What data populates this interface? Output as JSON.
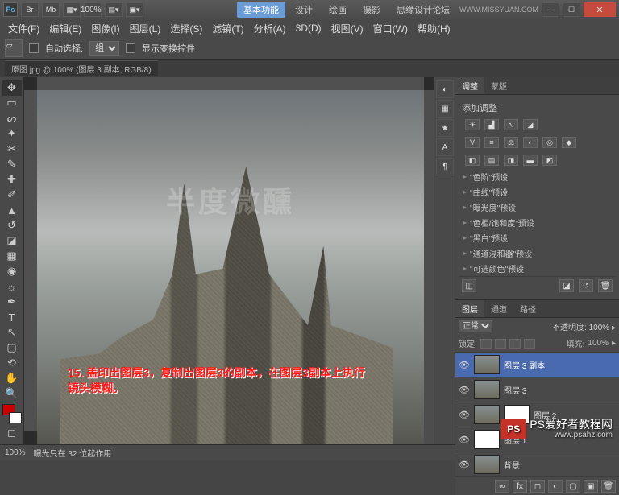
{
  "titlebar": {
    "app_abbr": "Ps",
    "zoom": "100%",
    "basic_label": "基本功能",
    "mode_design": "设计",
    "mode_paint": "绘画",
    "mode_photo": "摄影",
    "site_text": "思缘设计论坛",
    "url": "WWW.MISSYUAN.COM"
  },
  "menu": {
    "file": "文件(F)",
    "edit": "编辑(E)",
    "image": "图像(I)",
    "layer": "图层(L)",
    "select": "选择(S)",
    "filter": "滤镜(T)",
    "analysis": "分析(A)",
    "threed": "3D(D)",
    "view": "视图(V)",
    "window": "窗口(W)",
    "help": "帮助(H)"
  },
  "options": {
    "auto_select": "自动选择:",
    "group": "组",
    "show_transform": "显示变换控件"
  },
  "document": {
    "tab_label": "原图.jpg @ 100% (图层 3 副本, RGB/8)"
  },
  "annotation": {
    "line1": "15. 盖印出图层3，复制出图层3的副本，在图层3副本上执行",
    "line2": "镜头模糊。"
  },
  "watermark_center": "半度微醺",
  "adjustments_panel": {
    "tab1": "调整",
    "tab2": "蒙版",
    "heading": "添加调整",
    "presets": [
      "\"色阶\"预设",
      "\"曲线\"预设",
      "\"曝光度\"预设",
      "\"色相/饱和度\"预设",
      "\"黑白\"预设",
      "\"通道混和器\"预设",
      "\"可选颜色\"预设"
    ]
  },
  "layers_panel": {
    "tab_layers": "图层",
    "tab_channels": "通道",
    "tab_paths": "路径",
    "blend_mode": "正常",
    "opacity_label": "不透明度:",
    "opacity_value": "100%",
    "lock_label": "锁定:",
    "fill_label": "填充:",
    "fill_value": "100%",
    "layers": [
      {
        "name": "图层 3 副本",
        "selected": true
      },
      {
        "name": "图层 3",
        "selected": false
      },
      {
        "name": "图层 2",
        "selected": false
      },
      {
        "name": "图层 1",
        "selected": false
      },
      {
        "name": "背景",
        "selected": false
      }
    ]
  },
  "status": {
    "zoom": "100%",
    "info": "曝光只在 32 位起作用"
  },
  "watermark_br": {
    "logo": "PS",
    "text": "PS爱好者教程网",
    "sub": "www.psahz.com"
  }
}
